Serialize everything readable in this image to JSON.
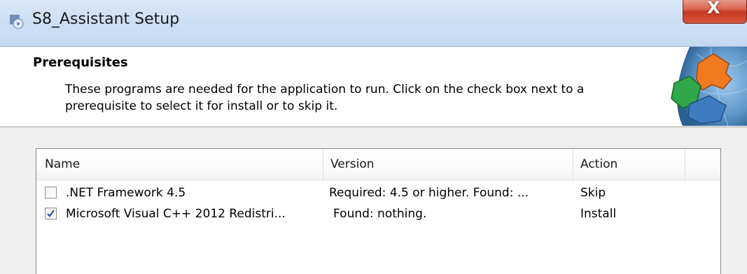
{
  "window": {
    "title": "S8_Assistant Setup",
    "close_label": "X"
  },
  "banner": {
    "title": "Prerequisites",
    "description": "These programs are needed for the application to run. Click on the check box next to a prerequisite to select it for install or to skip it."
  },
  "table": {
    "columns": [
      "Name",
      "Version",
      "Action"
    ],
    "rows": [
      {
        "checked": false,
        "name": ".NET Framework 4.5",
        "version": "Required: 4.5 or higher. Found: ...",
        "action": "Skip"
      },
      {
        "checked": true,
        "name": "Microsoft Visual C++ 2012 Redistri...",
        "version": "Found: nothing.",
        "action": "Install"
      }
    ]
  },
  "colors": {
    "titlebar": "#cddff4",
    "close_button": "#c73a22",
    "check": "#2a4d9b"
  }
}
